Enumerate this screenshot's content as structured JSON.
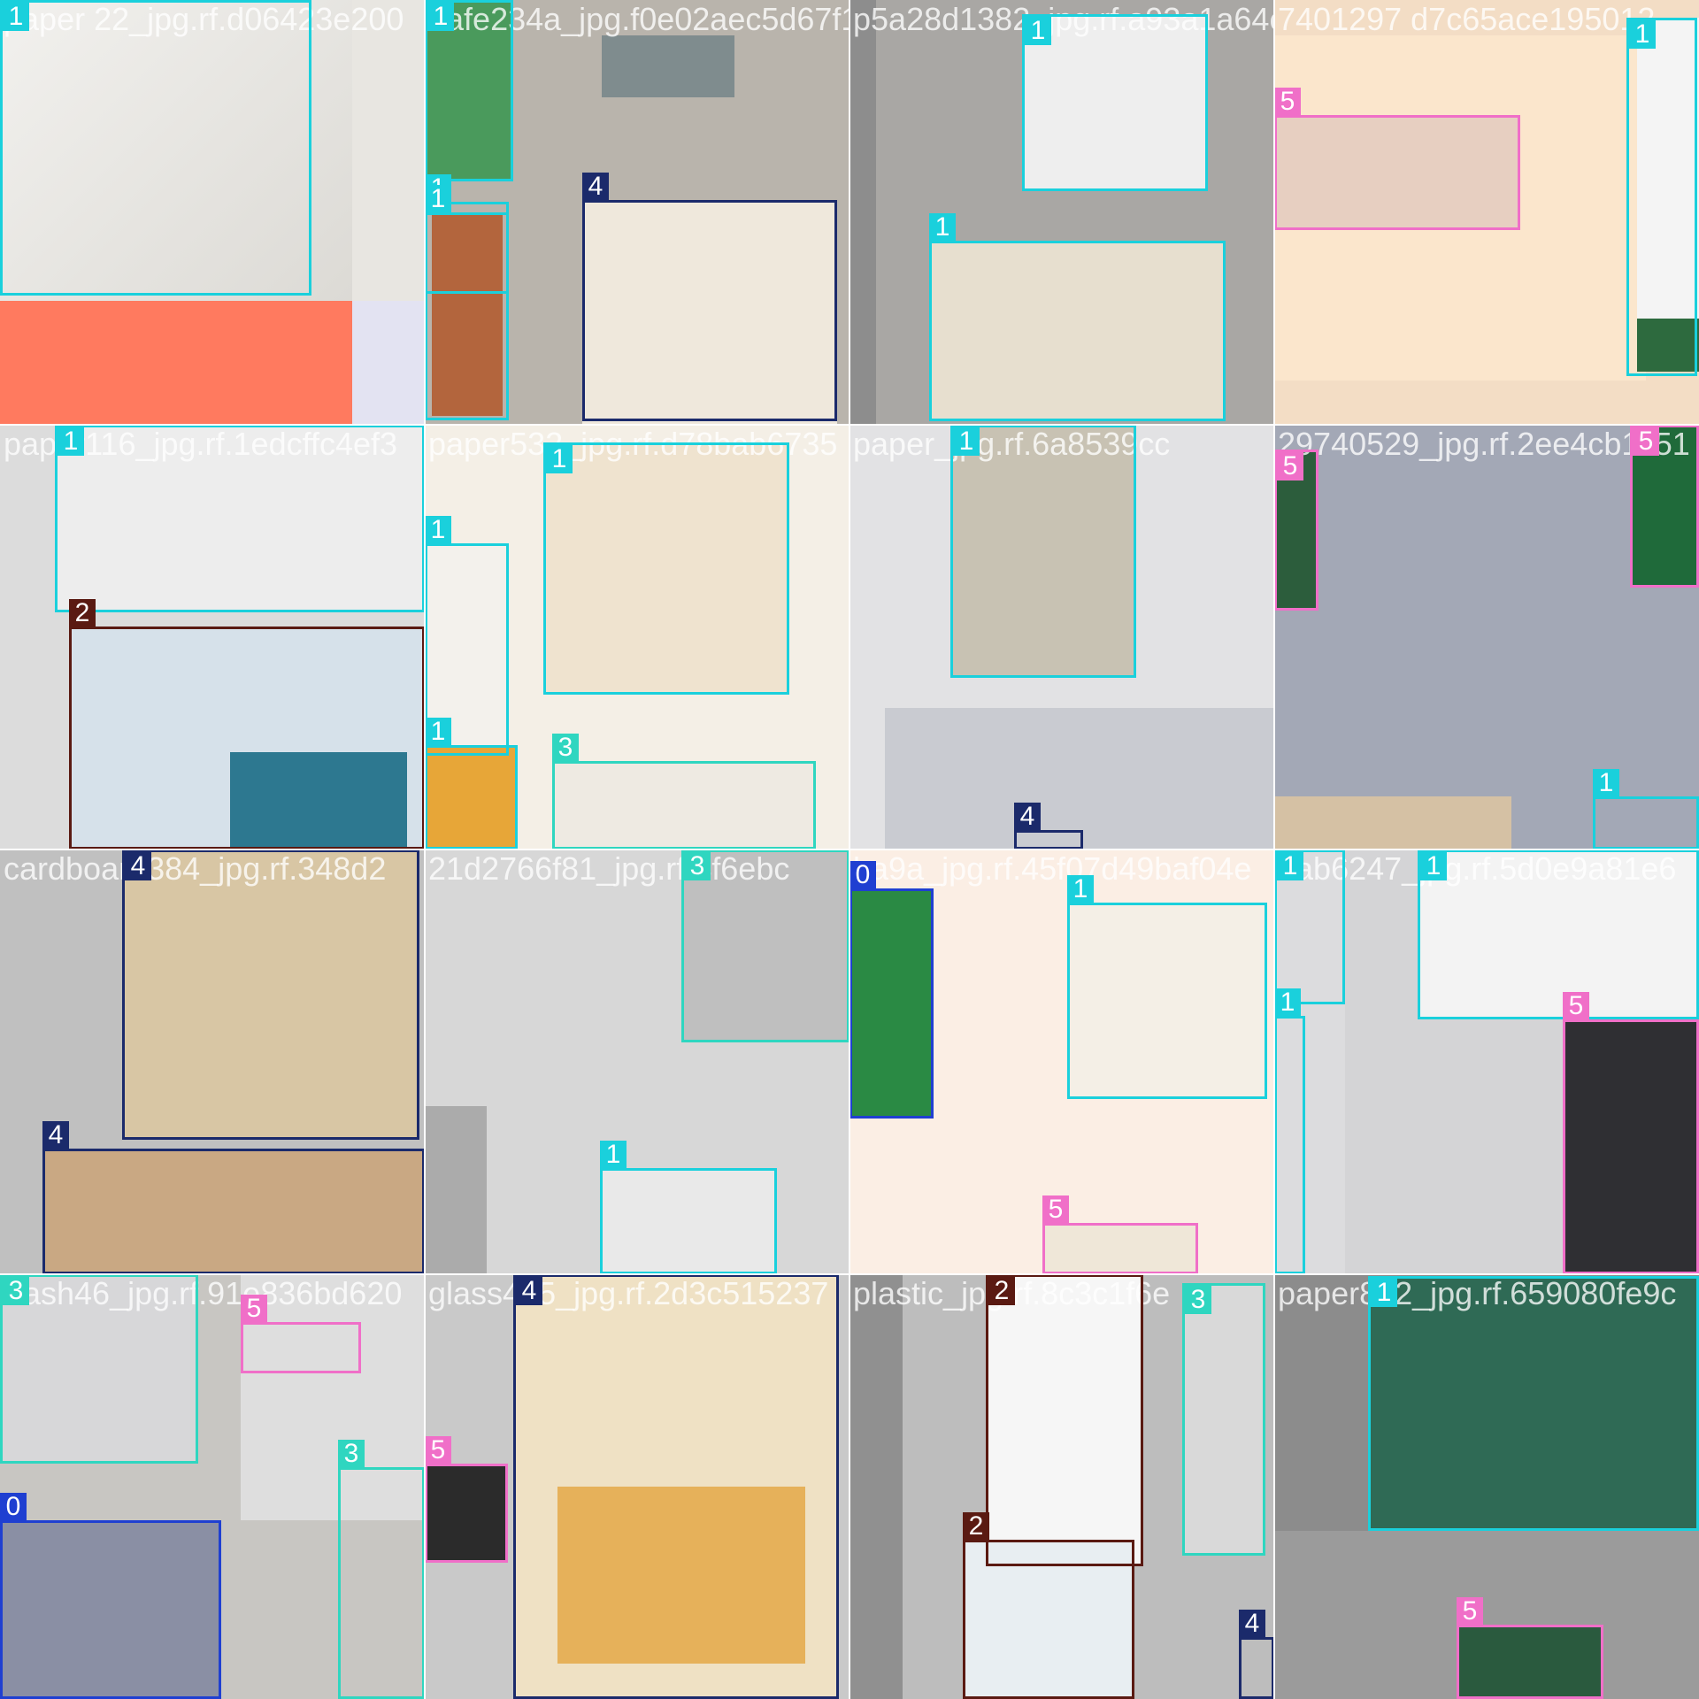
{
  "class_colors": {
    "0": "#1f3fd1",
    "1": "#1ad0dc",
    "2": "#5a1a12",
    "3": "#2fd6c0",
    "4": "#1b2a6b",
    "5": "#f06fc8"
  },
  "tiles": [
    {
      "filename": "paper 22_jpg.rf.d06423e200",
      "bg": "#e8e6e1"
    },
    {
      "filename": "1afe234a_jpg.f0e02aec5d67f1",
      "bg": "#b9b4ac"
    },
    {
      "filename": "p5a28d1382_jpg.rf.a93a1a64c",
      "bg": "#a9a7a4"
    },
    {
      "filename": "7401297 d7c65ace195012",
      "bg": "#f3ddc5"
    },
    {
      "filename": "paper116_jpg.rf.1edcffc4ef3",
      "bg": "#dcdcdc"
    },
    {
      "filename": "paper532_jpg.rf.d78bab6735",
      "bg": "#f4efe6"
    },
    {
      "filename": "paper_jpg.rf.6a8539cc",
      "bg": "#e2e2e4"
    },
    {
      "filename": "29740529_jpg.rf.2ee4cb1151",
      "bg": "#9ea3b0"
    },
    {
      "filename": "cardboard384_jpg.rf.348d2",
      "bg": "#c0c0c0"
    },
    {
      "filename": "21d2766f81_jpg.rf.4f6ebc",
      "bg": "#d7d7d7"
    },
    {
      "filename": "ba9a_jpg.rf.45f07d49baf04e",
      "bg": "#fbeee4"
    },
    {
      "filename": "1ab6247_jpg.rf.5d0e9a81e6",
      "bg": "#d4d4d6"
    },
    {
      "filename": "trash46_jpg.rf.91e836bd620",
      "bg": "#c8c6c2"
    },
    {
      "filename": "glass475_jpg.rf.2d3c515237",
      "bg": "#c9c9c9"
    },
    {
      "filename": "plastic_jpg.rf.8c3c1f6e",
      "bg": "#bdbdbd"
    },
    {
      "filename": "paper802_jpg.rf.659080fe9c",
      "bg": "#8c8c8c"
    }
  ],
  "detections": [
    {
      "tile": 0,
      "label": "1",
      "cls": "1"
    },
    {
      "tile": 1,
      "label": "1",
      "cls": "1"
    },
    {
      "tile": 1,
      "label": "1",
      "cls": "1"
    },
    {
      "tile": 1,
      "label": "1",
      "cls": "1"
    },
    {
      "tile": 1,
      "label": "4",
      "cls": "4"
    },
    {
      "tile": 2,
      "label": "1",
      "cls": "1"
    },
    {
      "tile": 2,
      "label": "1",
      "cls": "1"
    },
    {
      "tile": 3,
      "label": "5",
      "cls": "5"
    },
    {
      "tile": 3,
      "label": "1",
      "cls": "1"
    },
    {
      "tile": 4,
      "label": "1",
      "cls": "1"
    },
    {
      "tile": 4,
      "label": "2",
      "cls": "2"
    },
    {
      "tile": 5,
      "label": "1",
      "cls": "1"
    },
    {
      "tile": 5,
      "label": "1",
      "cls": "1"
    },
    {
      "tile": 5,
      "label": "1",
      "cls": "1"
    },
    {
      "tile": 5,
      "label": "3",
      "cls": "3"
    },
    {
      "tile": 6,
      "label": "1",
      "cls": "1"
    },
    {
      "tile": 6,
      "label": "4",
      "cls": "4"
    },
    {
      "tile": 7,
      "label": "5",
      "cls": "5"
    },
    {
      "tile": 7,
      "label": "5",
      "cls": "5"
    },
    {
      "tile": 7,
      "label": "1",
      "cls": "1"
    },
    {
      "tile": 8,
      "label": "4",
      "cls": "4"
    },
    {
      "tile": 8,
      "label": "4",
      "cls": "4"
    },
    {
      "tile": 9,
      "label": "3",
      "cls": "3"
    },
    {
      "tile": 9,
      "label": "1",
      "cls": "1"
    },
    {
      "tile": 10,
      "label": "0",
      "cls": "0"
    },
    {
      "tile": 10,
      "label": "1",
      "cls": "1"
    },
    {
      "tile": 10,
      "label": "5",
      "cls": "5"
    },
    {
      "tile": 11,
      "label": "1",
      "cls": "1"
    },
    {
      "tile": 11,
      "label": "1",
      "cls": "1"
    },
    {
      "tile": 11,
      "label": "1",
      "cls": "1"
    },
    {
      "tile": 11,
      "label": "5",
      "cls": "5"
    },
    {
      "tile": 12,
      "label": "3",
      "cls": "3"
    },
    {
      "tile": 12,
      "label": "5",
      "cls": "5"
    },
    {
      "tile": 12,
      "label": "0",
      "cls": "0"
    },
    {
      "tile": 12,
      "label": "3",
      "cls": "3"
    },
    {
      "tile": 13,
      "label": "4",
      "cls": "4"
    },
    {
      "tile": 13,
      "label": "5",
      "cls": "5"
    },
    {
      "tile": 14,
      "label": "2",
      "cls": "2"
    },
    {
      "tile": 14,
      "label": "3",
      "cls": "3"
    },
    {
      "tile": 14,
      "label": "2",
      "cls": "2"
    },
    {
      "tile": 14,
      "label": "4",
      "cls": "4"
    },
    {
      "tile": 15,
      "label": "1",
      "cls": "1"
    },
    {
      "tile": 15,
      "label": "5",
      "cls": "5"
    }
  ]
}
